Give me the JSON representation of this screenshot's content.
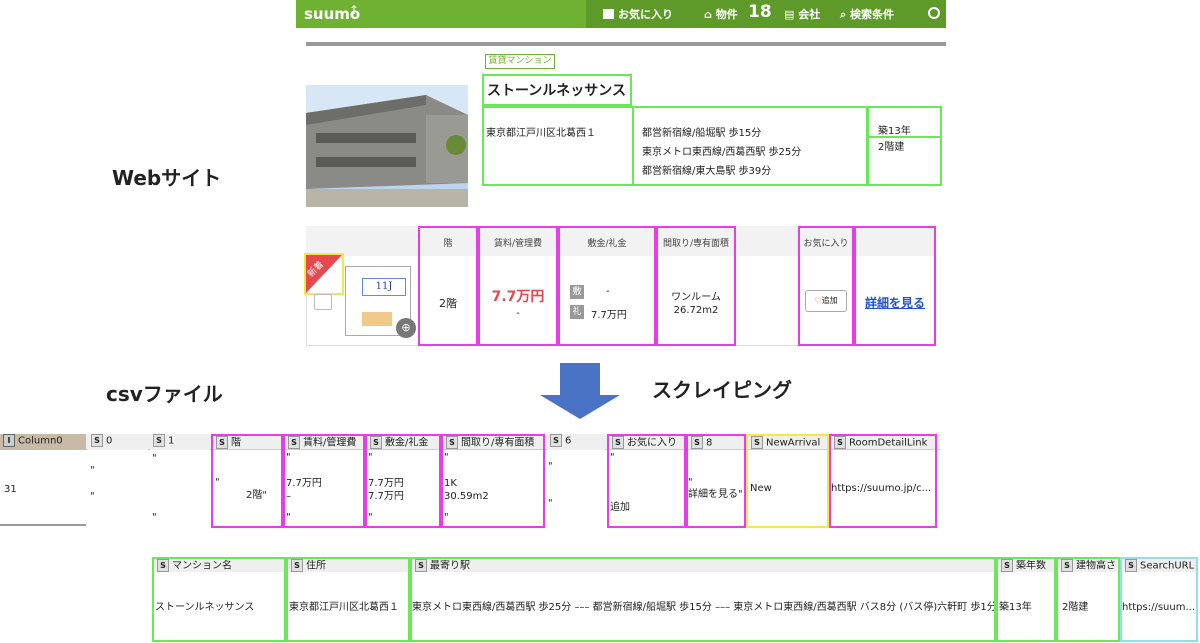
{
  "header": {
    "logo": "suumo",
    "favorites_label": "お気に入り",
    "properties_label": "物件",
    "properties_count": "18",
    "company_label": "会社",
    "search_label": "検索条件"
  },
  "labels": {
    "website": "Webサイト",
    "csv": "csvファイル",
    "scraping": "スクレイピング"
  },
  "building": {
    "type_tag": "賃貸マンション",
    "name": "ストーンルネッサンス",
    "address": "東京都江戸川区北葛西１",
    "stations": [
      "都営新宿線/船堀駅 歩15分",
      "東京メトロ東西線/西葛西駅 歩25分",
      "都営新宿線/東大島駅 歩39分"
    ],
    "age": "築13年",
    "floors": "2階建"
  },
  "room": {
    "new_badge": "新着",
    "plan_label": "11J",
    "headers": [
      "階",
      "賃料/管理費",
      "敷金/礼金",
      "間取り/専有面積",
      "お気に入り"
    ],
    "floor": "2階",
    "rent": "7.7万円",
    "mgmt_fee": "-",
    "deposit_badge": "敷",
    "deposit": "-",
    "key_money_badge": "礼",
    "key_money": "7.7万円",
    "layout": "ワンルーム",
    "area": "26.72m2",
    "fav_button": "追加",
    "detail_link": "詳細を見る"
  },
  "csv1": {
    "headers": [
      "Column0",
      "0",
      "1",
      "階",
      "賃料/管理費",
      "敷金/礼金",
      "間取り/専有面積",
      "6",
      "お気に入り",
      "8",
      "NewArrival",
      "RoomDetailLink"
    ],
    "index_value": "31",
    "floor_value": "2階\"",
    "rent_value": "7.7万円\n–",
    "deposit_value": "7.7万円\n7.7万円",
    "layout_value": "1K\n30.59m2",
    "fav_value": "追加",
    "detail_value": "詳細を見る\"",
    "new_value": "New",
    "link_value": "https://suumo.jp/c..."
  },
  "csv2": {
    "headers": [
      "マンション名",
      "住所",
      "最寄り駅",
      "築年数",
      "建物高さ",
      "SearchURL"
    ],
    "values": [
      "ストーンルネッサンス",
      "東京都江戸川区北葛西１",
      "東京メトロ東西線/西葛西駅 歩25分 ––– 都営新宿線/船堀駅 歩15分 ––– 東京メトロ東西線/西葛西駅 バス8分 (バス停)六軒町 歩1分",
      "築13年",
      "2階建",
      "https://suum..."
    ]
  }
}
